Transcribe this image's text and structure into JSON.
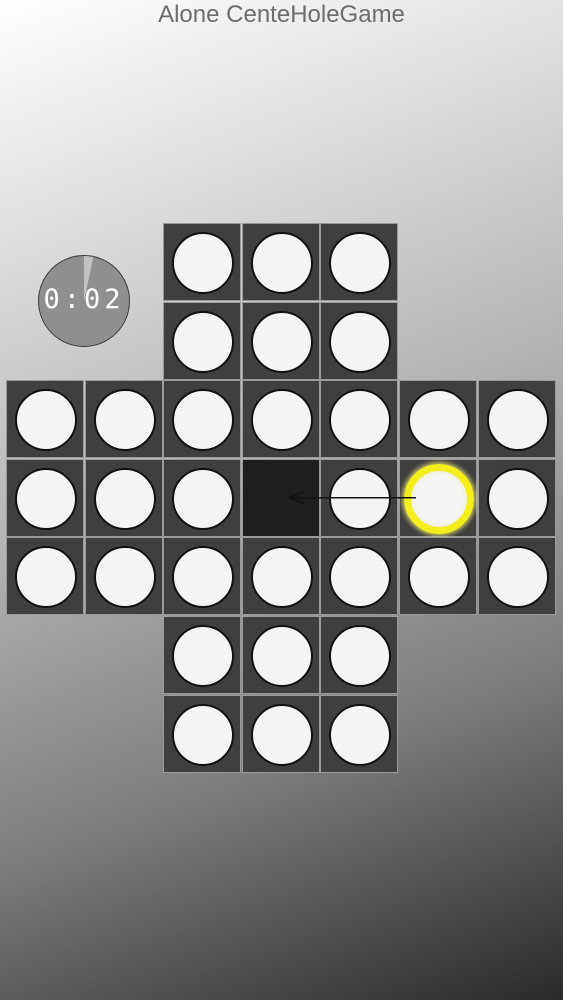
{
  "app": {
    "title": "Alone CenteHoleGame"
  },
  "timer": {
    "display": "0:02"
  },
  "board": {
    "type": "english-peg-solitaire",
    "rows": [
      [
        "-",
        "-",
        "P",
        "P",
        "P",
        "-",
        "-"
      ],
      [
        "-",
        "-",
        "P",
        "P",
        "P",
        "-",
        "-"
      ],
      [
        "P",
        "P",
        "P",
        "P",
        "P",
        "P",
        "P"
      ],
      [
        "P",
        "P",
        "P",
        "E",
        "P",
        "S",
        "P"
      ],
      [
        "P",
        "P",
        "P",
        "P",
        "P",
        "P",
        "P"
      ],
      [
        "-",
        "-",
        "P",
        "P",
        "P",
        "-",
        "-"
      ],
      [
        "-",
        "-",
        "P",
        "P",
        "P",
        "-",
        "-"
      ]
    ],
    "legend": {
      "P": "peg",
      "E": "empty hole",
      "S": "selected peg",
      "-": "no cell"
    },
    "selected_peg": {
      "row": 3,
      "col": 5
    },
    "move_hint": {
      "from": {
        "row": 3,
        "col": 5
      },
      "to": {
        "row": 3,
        "col": 3
      }
    }
  },
  "colors": {
    "cell": "#3f3f3f",
    "empty_hole": "#1e1e1e",
    "peg": "#f4f4f4",
    "selection_ring": "#f2ef1c"
  }
}
